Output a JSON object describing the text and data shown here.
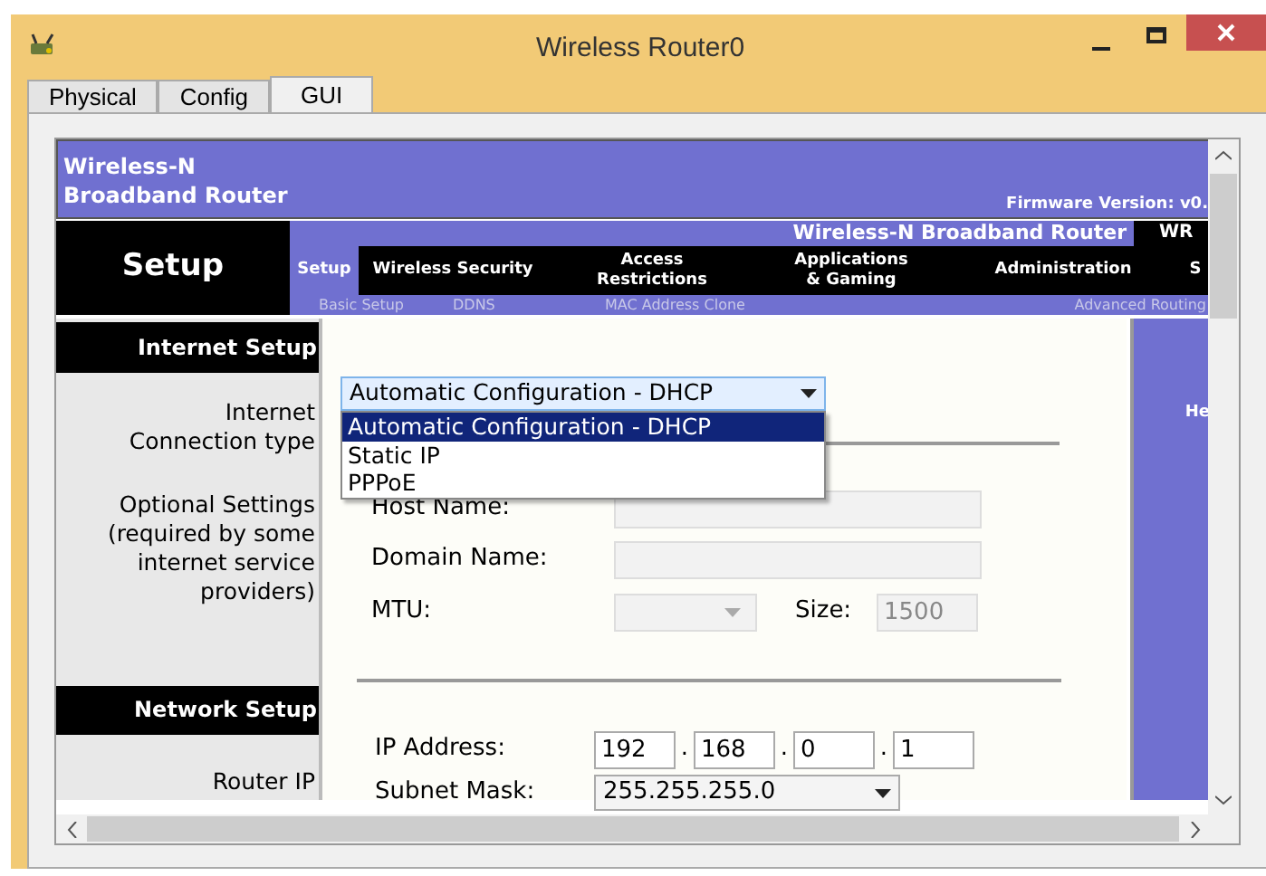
{
  "window": {
    "title": "Wireless Router0"
  },
  "tabs": [
    {
      "label": "Physical",
      "selected": false
    },
    {
      "label": "Config",
      "selected": false
    },
    {
      "label": "GUI",
      "selected": true
    }
  ],
  "router_page": {
    "brand": "Wireless-N\nBroadband Router",
    "firmware": "Firmware Version: v0.",
    "section_title": "Setup",
    "product_name": "Wireless-N Broadband Router",
    "model": "WR",
    "nav_tabs": [
      {
        "label": "Setup",
        "selected": true
      },
      {
        "label": "Wireless Security",
        "selected": false
      },
      {
        "label": "Access\nRestrictions",
        "selected": false
      },
      {
        "label": "Applications\n& Gaming",
        "selected": false
      },
      {
        "label": "Administration",
        "selected": false
      },
      {
        "label": "S",
        "selected": false
      }
    ],
    "sub_tabs": [
      "Basic Setup",
      "DDNS",
      "MAC Address Clone",
      "Advanced Routing"
    ],
    "internet_setup": {
      "heading": "Internet Setup",
      "connection_type_label": "Internet\nConnection type",
      "optional_label": "Optional Settings\n(required by some\ninternet service\nproviders)",
      "connection_type": {
        "value": "Automatic Configuration - DHCP",
        "expanded": true,
        "options": [
          {
            "label": "Automatic Configuration - DHCP",
            "selected": true
          },
          {
            "label": "Static IP",
            "selected": false
          },
          {
            "label": "PPPoE",
            "selected": false
          }
        ]
      },
      "host_name": {
        "label": "Host Name:",
        "disabled": true
      },
      "domain_name": {
        "label": "Domain Name:",
        "disabled": true
      },
      "mtu": {
        "label": "MTU:",
        "disabled": true,
        "size_label": "Size:",
        "size": "1500"
      }
    },
    "network_setup": {
      "heading": "Network Setup",
      "router_ip_label": "Router IP",
      "ip_address": {
        "label": "IP Address:",
        "octets": [
          "192",
          "168",
          "0",
          "1"
        ],
        "separators": [
          ".",
          ".",
          "."
        ]
      },
      "subnet_mask": {
        "label": "Subnet Mask:",
        "value": "255.255.255.0"
      }
    },
    "help": "He"
  }
}
